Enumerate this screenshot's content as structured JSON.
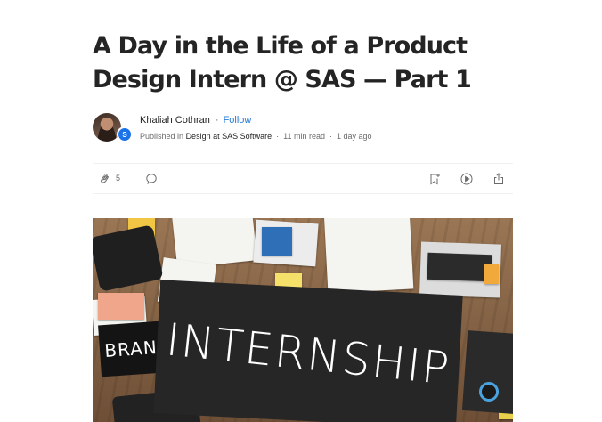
{
  "article": {
    "title": "A Day in the Life of a Product Design Intern @ SAS — Part 1"
  },
  "author": {
    "name": "Khaliah Cothran",
    "separator": "·",
    "follow_label": "Follow",
    "publication_badge": "S",
    "published_prefix": "Published in",
    "publication": "Design at SAS Software",
    "read_time": "11 min read",
    "posted": "1 day ago"
  },
  "actions": {
    "clap_count": "5",
    "icons": [
      "clap-icon",
      "comment-icon",
      "bookmark-add-icon",
      "listen-play-icon",
      "share-icon"
    ]
  },
  "hero_image": {
    "sign_text": "INTERNSHIP",
    "overlay_text": "BRAN"
  },
  "colors": {
    "text": "#242424",
    "muted": "#6b6b6b",
    "link": "#2a7bd6",
    "badge": "#1a73e8"
  }
}
